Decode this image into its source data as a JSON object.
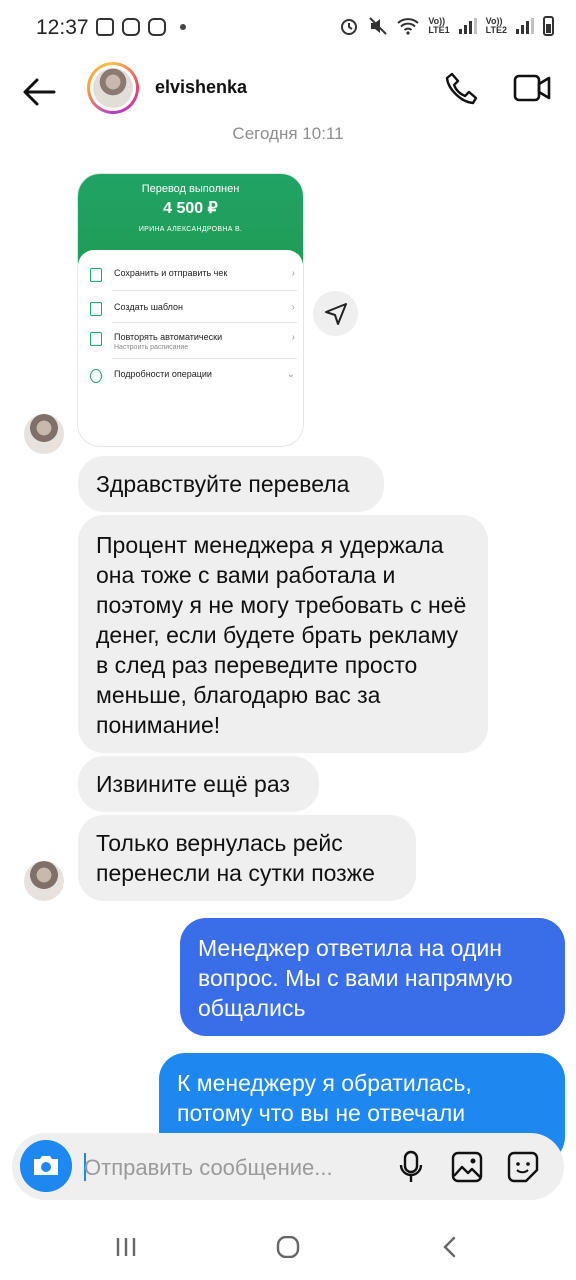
{
  "status_bar": {
    "time": "12:37",
    "sim1": "LTE1",
    "sim2": "LTE2",
    "volte": "Vo))"
  },
  "header": {
    "username": "elvishenka",
    "back_icon": "arrow-left-icon",
    "call_icon": "phone-icon",
    "video_icon": "video-camera-icon"
  },
  "conversation": {
    "timestamp": "Сегодня 10:11",
    "receipt": {
      "title": "Перевод выполнен",
      "amount": "4 500 ₽",
      "recipient": "ИРИНА АЛЕКСАНДРОВНА В.",
      "rows": [
        {
          "label": "Сохранить и отправить чек",
          "sub": ""
        },
        {
          "label": "Создать шаблон",
          "sub": ""
        },
        {
          "label": "Повторять автоматически",
          "sub": "Настроить расписание"
        },
        {
          "label": "Подробности операции",
          "sub": ""
        }
      ],
      "accent": "#21a366"
    },
    "messages": [
      {
        "from": "them",
        "text": "Здравствуйте перевела"
      },
      {
        "from": "them",
        "text": "Процент менеджера я удержала она тоже с вами работала и поэтому я не могу требовать с неё денег, если будете брать рекламу в след раз переведите просто меньше, благодарю вас за понимание!"
      },
      {
        "from": "them",
        "text": "Извините ещё раз"
      },
      {
        "from": "them",
        "text": "Только вернулась рейс перенесли на сутки позже"
      },
      {
        "from": "me",
        "text": "Менеджер ответила на один вопрос. Мы с вами напрямую общались"
      },
      {
        "from": "me",
        "text": "К менеджеру я обратилась, потому что вы не отвечали"
      }
    ]
  },
  "composer": {
    "placeholder": "Отправить сообщение...",
    "camera_icon": "camera-icon",
    "mic_icon": "microphone-icon",
    "gallery_icon": "image-gallery-icon",
    "sticker_icon": "sticker-icon"
  },
  "colors": {
    "my_bubble": "#3a6ee8",
    "my_bubble_2": "#1e88f0",
    "their_bubble": "#efefef"
  }
}
